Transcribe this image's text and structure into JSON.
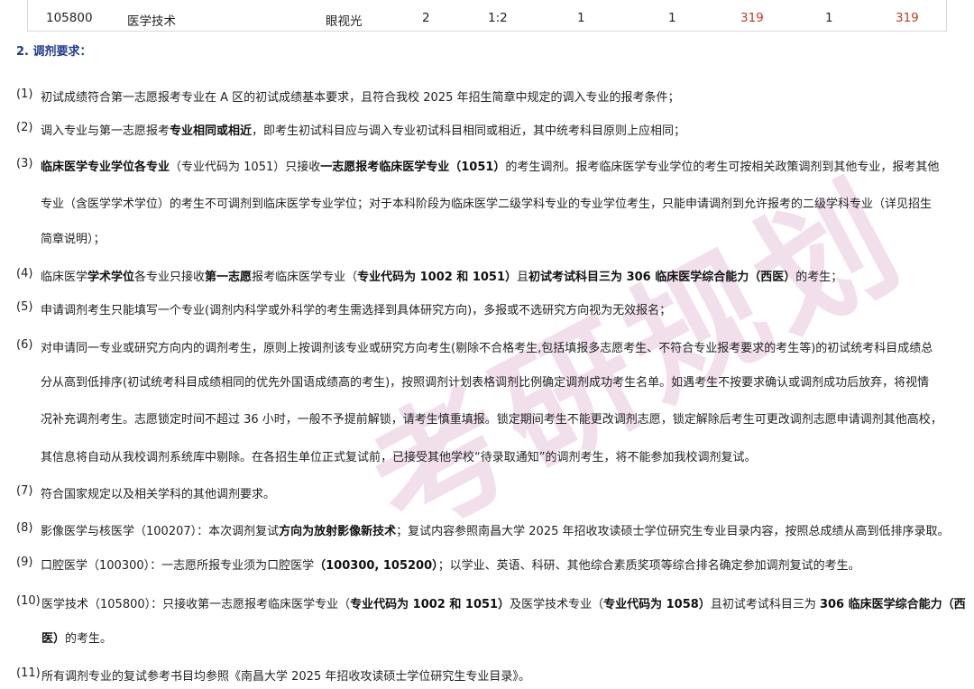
{
  "table_row": {
    "code": "105800",
    "major": "医学技术",
    "direction": "眼视光",
    "c1": "2",
    "ratio": "1:2",
    "c3": "1",
    "c4": "1",
    "score1": "319",
    "c6": "1",
    "score2": "319"
  },
  "section": {
    "title": "2. 调剂要求："
  },
  "items": [
    {
      "num": "(1)",
      "lines": [
        [
          {
            "t": "初试成绩符合第一志愿报考专业在 A  区的初试成绩基本要求，且符合我校 2025 年招生简章中规定的调入专业的报考条件；"
          }
        ]
      ]
    },
    {
      "num": "(2)",
      "lines": [
        [
          {
            "t": "调入专业与第一志愿报考"
          },
          {
            "t": "专业相同或相近",
            "b": 1
          },
          {
            "t": "，即考生初试科目应与调入专业初试科目相同或相近，其中统考科目原则上应相同；"
          }
        ]
      ]
    },
    {
      "num": "(3)",
      "lines": [
        [
          {
            "t": "临床医学专业学位各专业",
            "b": 1
          },
          {
            "t": "（专业代码为 1051）只接收"
          },
          {
            "t": "一志愿报考临床医学专业（1051）",
            "b": 1
          },
          {
            "t": "的考生调剂。报考临床医学专业学位的考生可按相关政策调剂到其他专业，报考其他"
          }
        ],
        [
          {
            "t": "专业（含医学学术学位）的考生不可调剂到临床医学专业学位；对于本科阶段为临床医学二级学科专业的专业学位考生，只能申请调剂到允许报考的二级学科专业（详见招生"
          }
        ],
        [
          {
            "t": "简章说明）；"
          }
        ]
      ]
    },
    {
      "num": "(4)",
      "lines": [
        [
          {
            "t": "临床医学"
          },
          {
            "t": "学术学位",
            "b": 1
          },
          {
            "t": "各专业只接收"
          },
          {
            "t": "第一志愿",
            "b": 1
          },
          {
            "t": "报考临床医学专业（"
          },
          {
            "t": "专业代码为 1002 和 1051）",
            "b": 1
          },
          {
            "t": "且"
          },
          {
            "t": "初试考试科目三为 306 临床医学综合能力（西医）",
            "b": 1
          },
          {
            "t": "的考生；"
          }
        ]
      ]
    },
    {
      "num": "(5)",
      "lines": [
        [
          {
            "t": "申请调剂考生只能填写一个专业(调剂内科学或外科学的考生需选择到具体研究方向)，多报或不选研究方向视为无效报名；"
          }
        ]
      ]
    },
    {
      "num": "(6)",
      "lines": [
        [
          {
            "t": "对申请同一专业或研究方向内的调剂考生，原则上按调剂该专业或研究方向考生(剔除不合格考生,包括填报多志愿考生、不符合专业报考要求的考生等)的初试统考科目成绩总"
          }
        ],
        [
          {
            "t": "分从高到低排序(初试统考科目成绩相同的优先外国语成绩高的考生)，按照调剂计划表格调剂比例确定调剂成功考生名单。如遇考生不按要求确认或调剂成功后放弃，将视情"
          }
        ],
        [
          {
            "t": "况补充调剂考生。志愿锁定时间不超过 36 小时，一般不予提前解锁，请考生慎重填报。锁定期间考生不能更改调剂志愿，锁定解除后考生可更改调剂志愿申请调剂其他高校，"
          }
        ],
        [
          {
            "t": "其信息将自动从我校调剂系统库中剔除。在各招生单位正式复试前，已接受其他学校“待录取通知”的调剂考生，将不能参加我校调剂复试。"
          }
        ]
      ]
    },
    {
      "num": "(7)",
      "lines": [
        [
          {
            "t": "符合国家规定以及相关学科的其他调剂要求。"
          }
        ]
      ]
    },
    {
      "num": "(8)",
      "lines": [
        [
          {
            "t": "影像医学与核医学（100207）：本次调剂复试"
          },
          {
            "t": "方向为放射影像新技术",
            "b": 1
          },
          {
            "t": "；复试内容参照南昌大学 2025 年招收攻读硕士学位研究生专业目录内容，按照总成绩从高到低排序录取。"
          }
        ]
      ]
    },
    {
      "num": "(9)",
      "lines": [
        [
          {
            "t": "口腔医学（100300）：一志愿所报专业须为口腔医学"
          },
          {
            "t": "（100300, 105200）",
            "b": 1
          },
          {
            "t": "；以学业、英语、科研、其他综合素质奖项等综合排名确定参加调剂复试的考生。"
          }
        ]
      ]
    },
    {
      "num": "(10)",
      "lines": [
        [
          {
            "t": "医学技术（105800）：只接收第一志愿报考临床医学专业（"
          },
          {
            "t": "专业代码为 1002 和 1051）",
            "b": 1
          },
          {
            "t": "及医学技术专业（"
          },
          {
            "t": "专业代码为 1058）",
            "b": 1
          },
          {
            "t": "且初试考试科目三为 "
          },
          {
            "t": "306 临床医学综合能力（西",
            "b": 1
          }
        ],
        [
          {
            "t": "医）",
            "b": 1
          },
          {
            "t": "的考生。"
          }
        ]
      ]
    },
    {
      "num": "(11)",
      "lines": [
        [
          {
            "t": "所有调剂专业的复试参考书目均参照《南昌大学 2025 年招收攻读硕士学位研究生专业目录》。"
          }
        ]
      ]
    }
  ],
  "watermark": {
    "text": "考研规划"
  },
  "colors": {
    "title_blue": "#1f3a93",
    "score_red": "#c0392b",
    "watermark": "#d8a3c9"
  }
}
